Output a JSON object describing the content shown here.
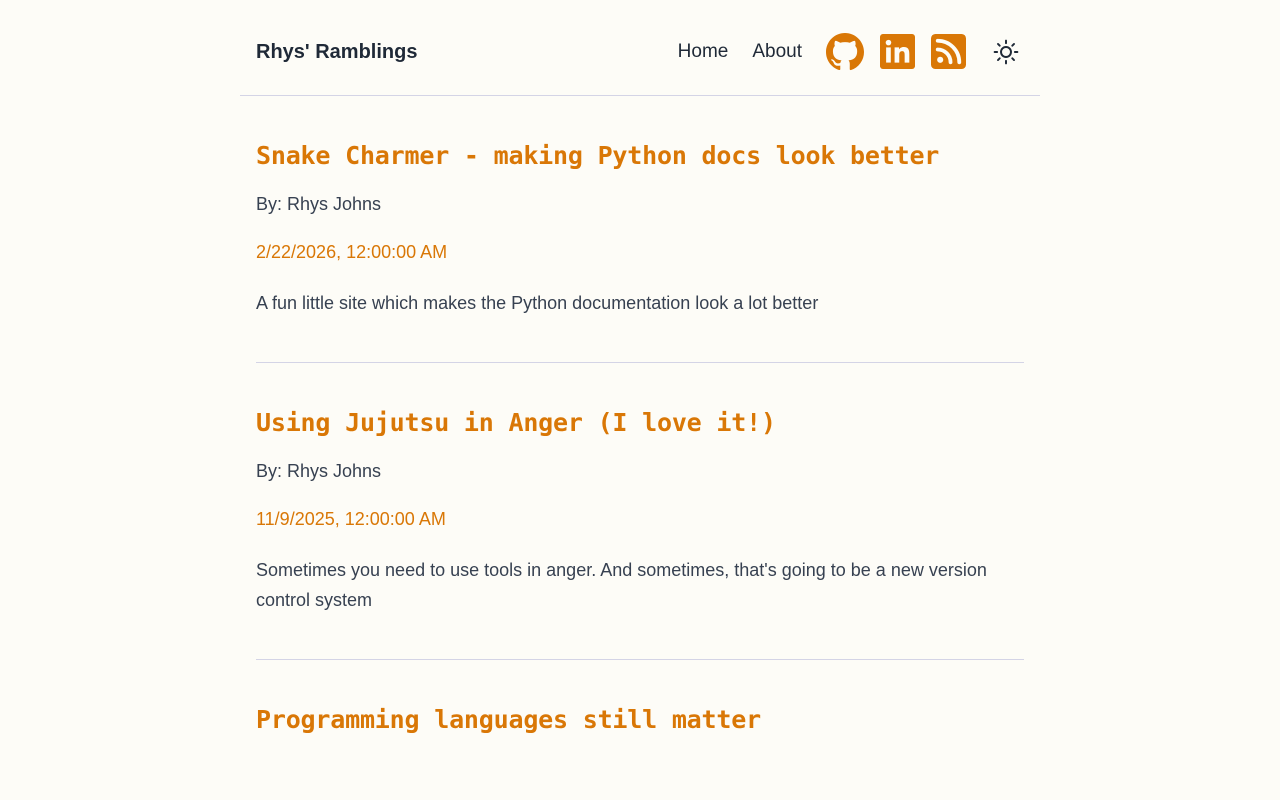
{
  "header": {
    "site_title": "Rhys' Ramblings",
    "nav": [
      {
        "label": "Home"
      },
      {
        "label": "About"
      }
    ],
    "icons": {
      "github": "github-icon",
      "linkedin": "linkedin-icon",
      "rss": "rss-icon",
      "theme": "sun-icon"
    },
    "accent_color": "#d97706"
  },
  "posts": [
    {
      "title": "Snake Charmer - making Python docs look better",
      "author": "By: Rhys Johns",
      "date": "2/22/2026, 12:00:00 AM",
      "summary": "A fun little site which makes the Python documentation look a lot better"
    },
    {
      "title": "Using Jujutsu in Anger (I love it!)",
      "author": "By: Rhys Johns",
      "date": "11/9/2025, 12:00:00 AM",
      "summary": "Sometimes you need to use tools in anger. And sometimes, that's going to be a new version control system"
    },
    {
      "title": "Programming languages still matter"
    }
  ]
}
